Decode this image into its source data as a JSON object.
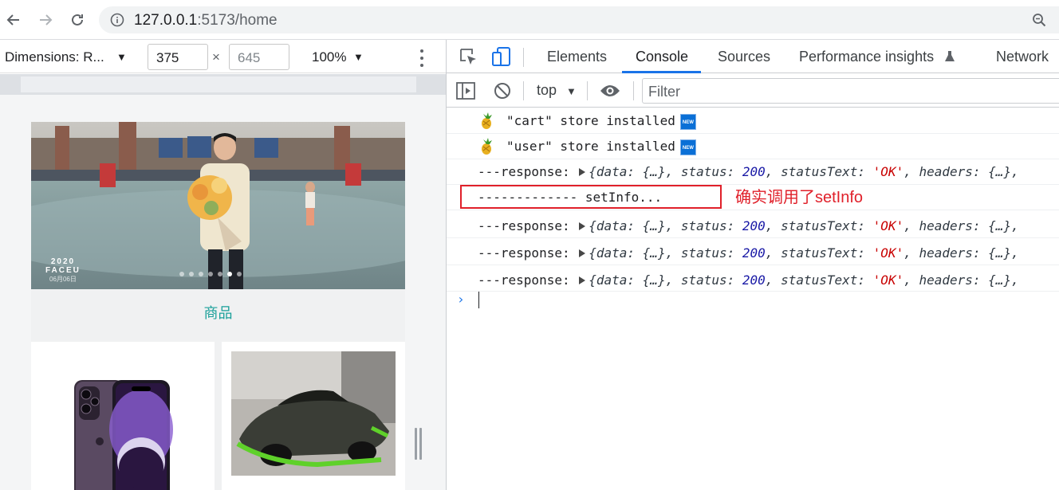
{
  "browser": {
    "url_host": "127.0.0.1",
    "url_rest": ":5173/home"
  },
  "device_toolbar": {
    "dimensions_label": "Dimensions: R...",
    "width": "375",
    "height": "645",
    "times": "×",
    "zoom": "100%"
  },
  "page": {
    "banner_watermark_year": "2020",
    "banner_watermark_brand": "FACEU",
    "banner_watermark_date": "06月06日",
    "carousel_total": 7,
    "carousel_active": 6,
    "category_title": "商品"
  },
  "devtools": {
    "tabs": [
      "Elements",
      "Console",
      "Sources",
      "Performance insights",
      "Network"
    ],
    "active_tab": "Console",
    "context": "top",
    "filter_placeholder": "Filter",
    "console": {
      "store1": "\"cart\" store installed",
      "store2": "\"user\" store installed",
      "new_badge": "NEW",
      "resp_prefix": "---response: ",
      "resp_open": "{data: ",
      "resp_data_val": "{…}",
      "resp_status_key": ", status: ",
      "resp_status_val": "200",
      "resp_statustext_key": ", statusText: ",
      "resp_statustext_val": "'OK'",
      "resp_headers_key": ", headers: ",
      "resp_headers_val": "{…},",
      "setinfo": "------------- setInfo...",
      "prompt": "›"
    },
    "annotation": "确实调用了setInfo"
  }
}
